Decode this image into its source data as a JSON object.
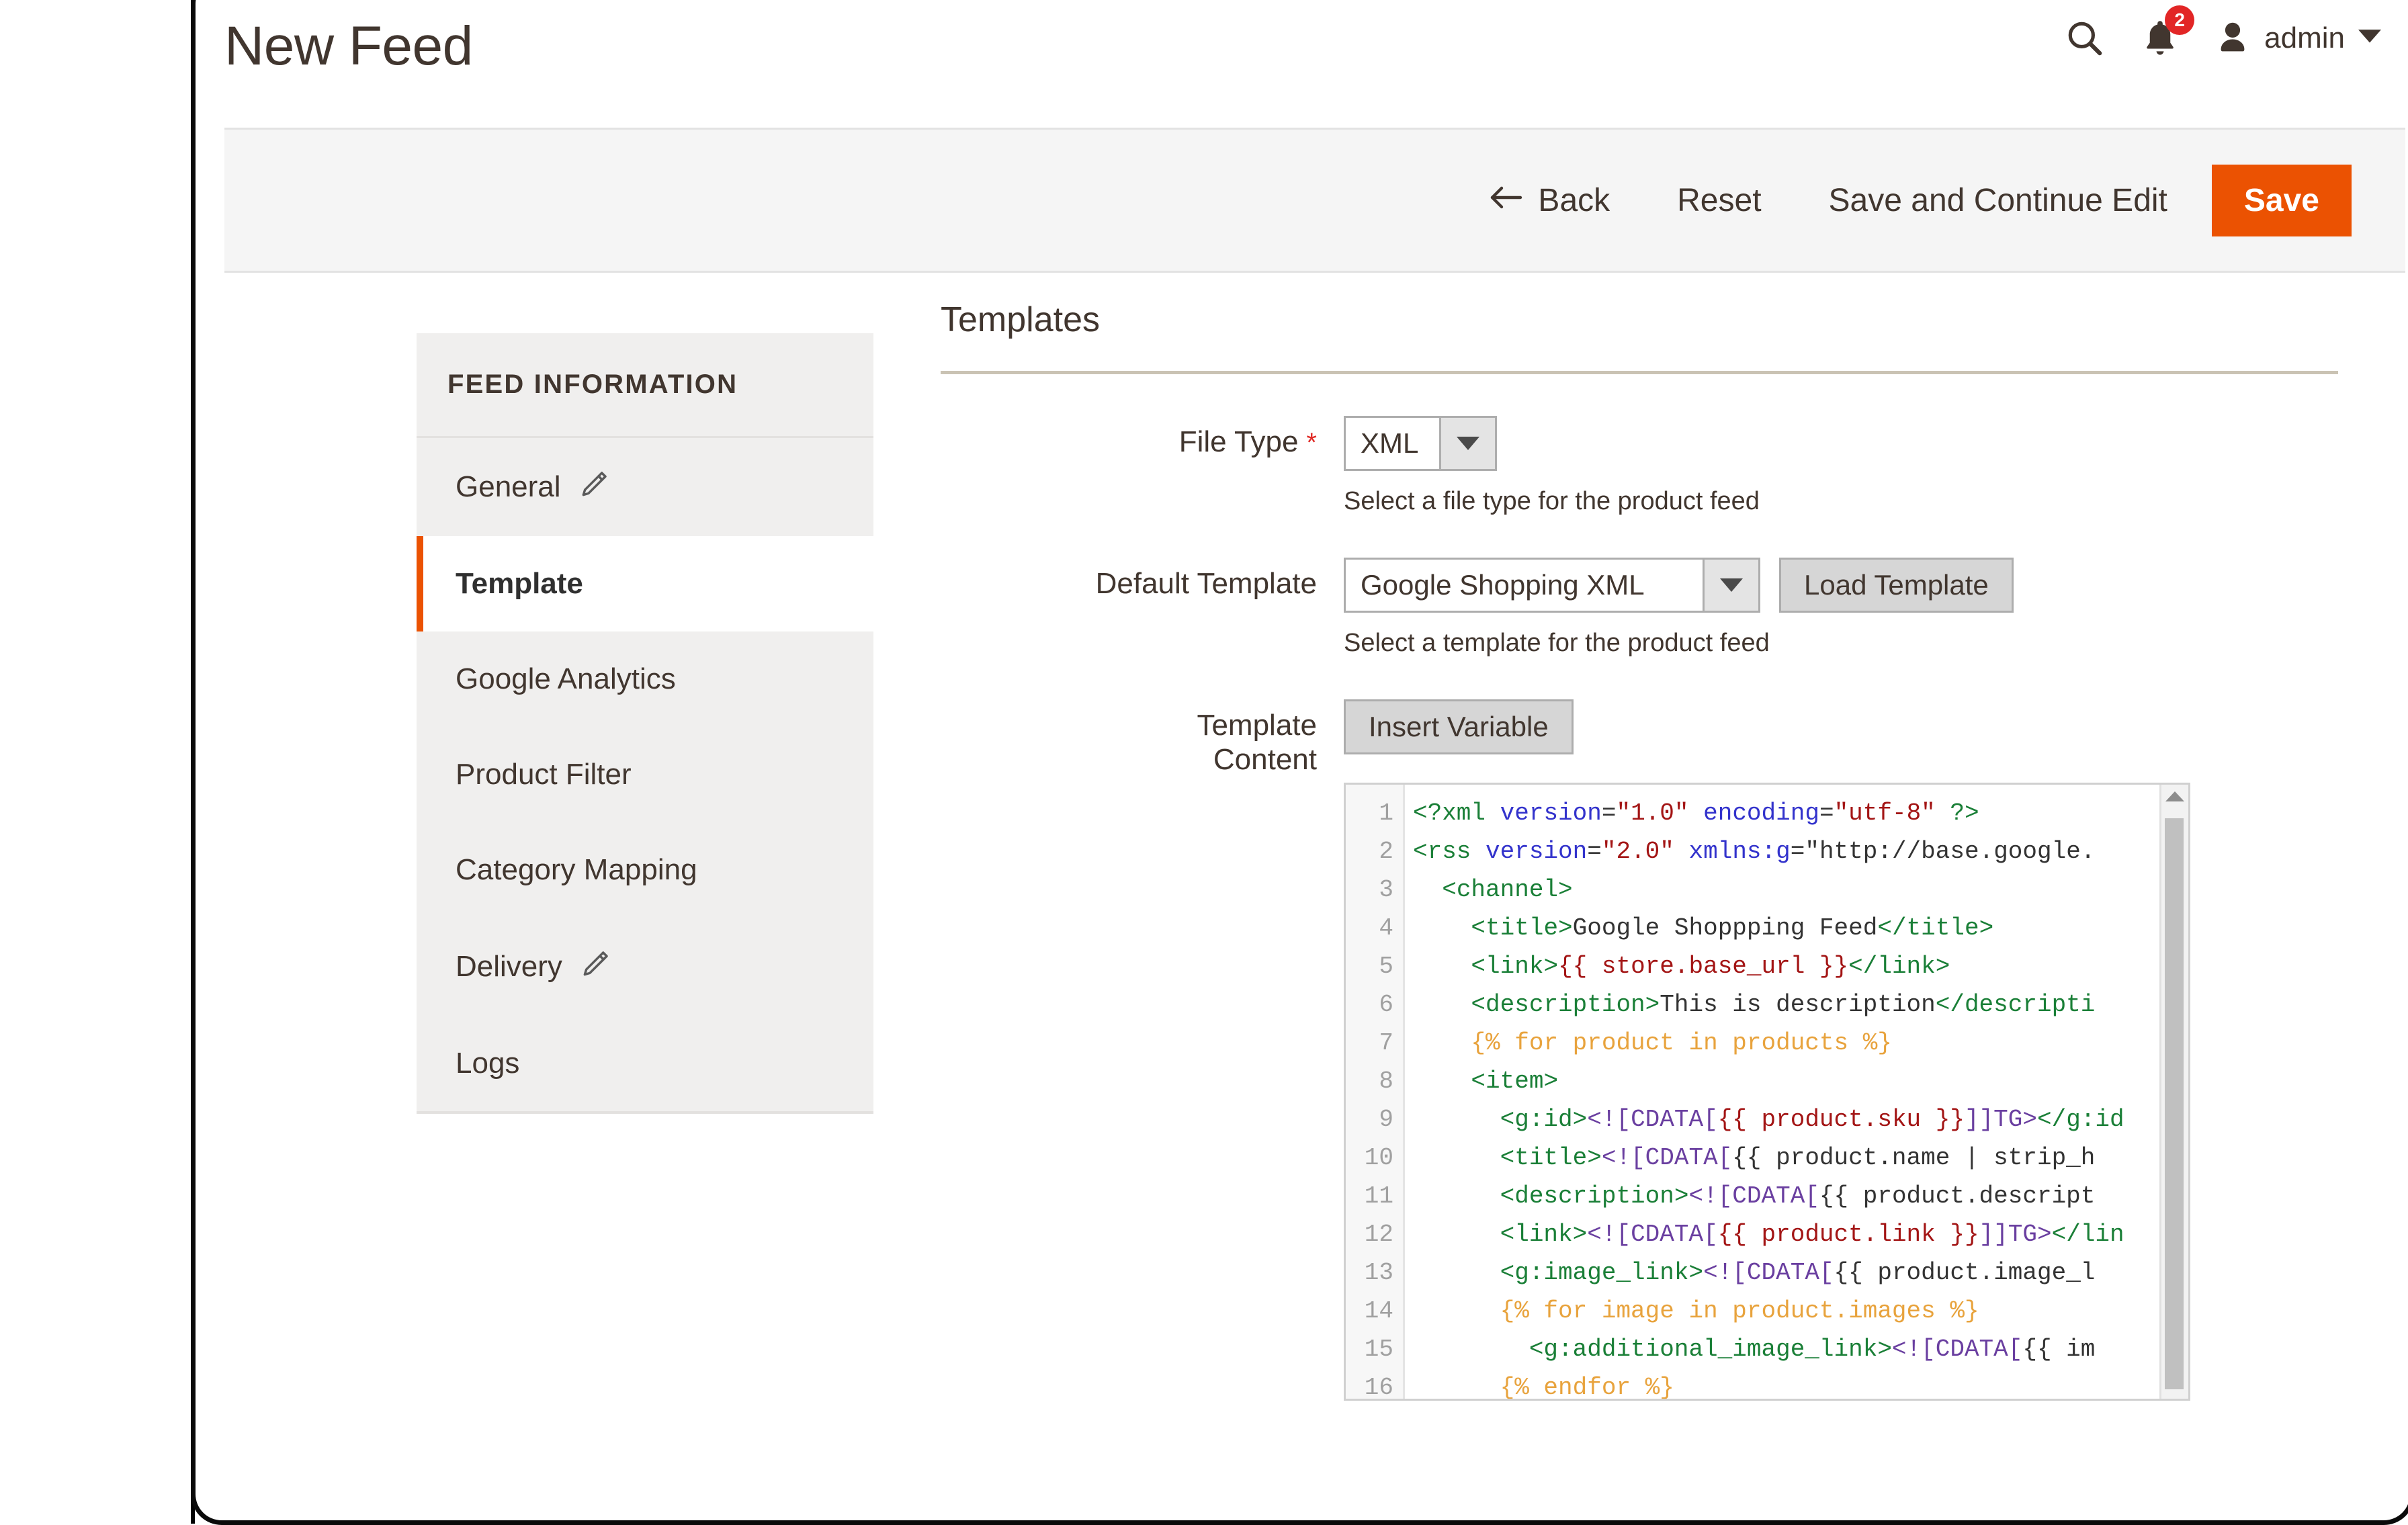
{
  "header": {
    "title": "New Feed",
    "search_icon": "search-icon",
    "notifications_icon": "bell-icon",
    "notifications_count": "2",
    "user_icon": "user-avatar-icon",
    "user_name": "admin",
    "user_caret_icon": "chevron-down-icon"
  },
  "toolbar": {
    "back_icon": "arrow-left-icon",
    "back": "Back",
    "reset": "Reset",
    "save_and_continue": "Save and Continue Edit",
    "save": "Save",
    "save_bg_color": "#eb5202"
  },
  "sidebar": {
    "title": "FEED INFORMATION",
    "active_accent_color": "#eb5202",
    "items": [
      {
        "label": "General",
        "icon": "pencil-icon",
        "has_icon": true,
        "active": false
      },
      {
        "label": "Template",
        "icon": "",
        "has_icon": false,
        "active": true
      },
      {
        "label": "Google Analytics",
        "icon": "",
        "has_icon": false,
        "active": false
      },
      {
        "label": "Product Filter",
        "icon": "",
        "has_icon": false,
        "active": false
      },
      {
        "label": "Category Mapping",
        "icon": "",
        "has_icon": false,
        "active": false
      },
      {
        "label": "Delivery",
        "icon": "pencil-icon",
        "has_icon": true,
        "active": false
      },
      {
        "label": "Logs",
        "icon": "",
        "has_icon": false,
        "active": false
      }
    ]
  },
  "main": {
    "section_title": "Templates",
    "file_type": {
      "label": "File Type",
      "required_marker": "*",
      "value": "XML",
      "hint": "Select a file type for the product feed"
    },
    "default_template": {
      "label": "Default Template",
      "value": "Google Shopping XML",
      "load_button": "Load Template",
      "hint": "Select a template for the product feed"
    },
    "template_content": {
      "label_line1": "Template",
      "label_line2": "Content",
      "insert_variable_button": "Insert Variable",
      "line_numbers": [
        "1",
        "2",
        "3",
        "4",
        "5",
        "6",
        "7",
        "8",
        "9",
        "10",
        "11",
        "12",
        "13",
        "14",
        "15",
        "16"
      ],
      "code_lines": [
        "<?xml version=\"1.0\" encoding=\"utf-8\" ?>",
        "<rss version=\"2.0\" xmlns:g=\"http://base.google.",
        "  <channel>",
        "    <title>Google Shoppping Feed</title>",
        "    <link>{{ store.base_url }}</link>",
        "    <description>This is description</descripti",
        "    {% for product in products %}",
        "    <item>",
        "      <g:id><![CDATA[{{ product.sku }}]]></g:id",
        "      <title><![CDATA[{{ product.name | strip_h",
        "      <description><![CDATA[{{ product.descript",
        "      <link><![CDATA[{{ product.link }}]]></lin",
        "      <g:image_link><![CDATA[{{ product.image_l",
        "      {% for image in product.images %}",
        "        <g:additional_image_link><![CDATA[{{ im",
        "      {% endfor %}"
      ]
    }
  }
}
